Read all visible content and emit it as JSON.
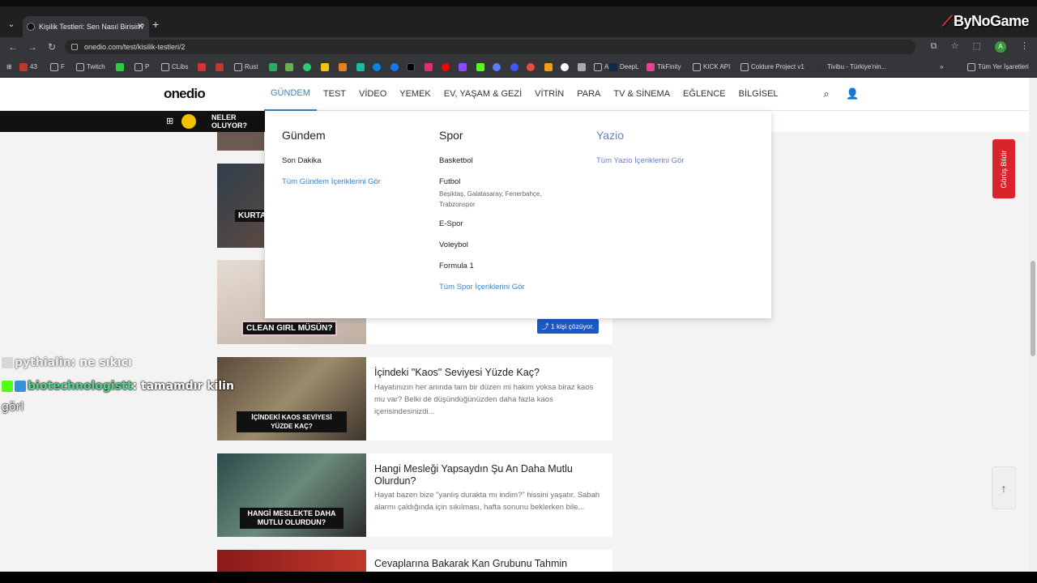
{
  "browser": {
    "tab_title": "Kişilik Testleri: Sen Nasıl Birisin?",
    "url": "onedio.com/test/kisilik-testleri/2",
    "overlay_logo": "ByNoGame",
    "bookmarks": [
      "43",
      "F",
      "Twitch",
      "P",
      "CLibs",
      "Rust",
      "AI",
      "DeepL",
      "TikFinity",
      "KICK API",
      "Coldure Project v1",
      "Tivibu - Türkiye'nin...",
      "Tüm Yer İşaretleri"
    ]
  },
  "site": {
    "logo": "onedio",
    "nav": [
      "GÜNDEM",
      "TEST",
      "VİDEO",
      "YEMEK",
      "EV, YAŞAM & GEZİ",
      "VİTRİN",
      "PARA",
      "TV & SİNEMA",
      "EĞLENCE",
      "BİLGİSEL"
    ],
    "neler_line1": "NELER",
    "neler_line2": "OLUYOR?"
  },
  "dropdown": {
    "gundem": {
      "title": "Gündem",
      "links": [
        "Son Dakika"
      ],
      "all": "Tüm Gündem İçeriklerini Gör"
    },
    "spor": {
      "title": "Spor",
      "basketbol": "Basketbol",
      "futbol": "Futbol",
      "futbol_sub": "Beşiktaş, Galatasaray, Fenerbahçe, Trabzonspor",
      "espor": "E-Spor",
      "voleybol": "Voleybol",
      "formula": "Formula 1",
      "all": "Tüm Spor İçeriklerini Gör"
    },
    "yazio": {
      "title": "Yazio",
      "all": "Tüm Yazio İçeriklerini Gör"
    }
  },
  "cards": [
    {
      "thumb_label": "KURTA",
      "title": "",
      "desc": ""
    },
    {
      "thumb_label": "CLEAN GIRL MÜSÜN?",
      "badge": "1 kişi çözüyor.",
      "title": "",
      "desc": ""
    },
    {
      "thumb_label": "İÇİNDEKİ KAOS SEVİYESİ YÜZDE KAÇ?",
      "title": "İçindeki \"Kaos\" Seviyesi Yüzde Kaç?",
      "desc": "Hayatınızın her anında tam bir düzen mi hakim yoksa biraz kaos mu var? Belki de düşündüğünüzden daha fazla kaos içerisindesinizdi..."
    },
    {
      "thumb_label": "HANGİ MESLEKTE DAHA MUTLU OLURDUN?",
      "title": "Hangi Mesleği Yapsaydın Şu An Daha Mutlu Olurdun?",
      "desc": "Hayat bazen bize \"yanlış durakta mı indim?\" hissini yaşatır. Sabah alarmı çaldığında için sıkılması, hafta sonunu beklerken bile..."
    },
    {
      "thumb_label": "",
      "title": "Cevaplarına Bakarak Kan Grubunu Tahmin",
      "desc": ""
    }
  ],
  "feedback": "Görüş Bildir",
  "chat": [
    {
      "user": "pythialin",
      "msg": ": ne sıkıcı"
    },
    {
      "user": "biotechnologistt",
      "msg": ": tamamdır kilin"
    },
    {
      "user": "",
      "msg": "görl"
    }
  ],
  "colors": {
    "accent": "#3b82c4",
    "badge": "#1d58c9",
    "feedback": "#d9232d"
  }
}
